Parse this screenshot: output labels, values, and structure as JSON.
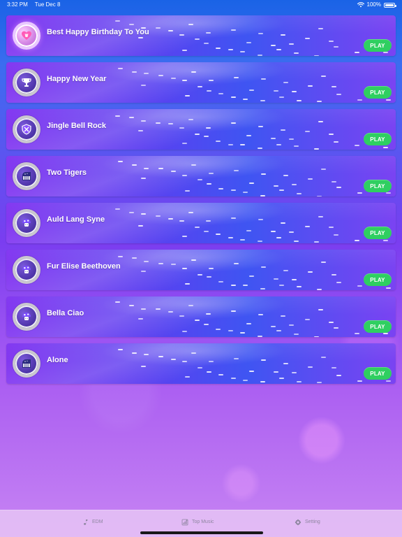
{
  "status_bar": {
    "time": "3:32 PM",
    "date": "Tue Dec 8",
    "battery": "100%",
    "icons": [
      "wifi-icon",
      "battery-icon"
    ]
  },
  "songs": [
    {
      "title": "Best Happy Birthday To You",
      "button": "PLAY",
      "icon": "heart-icon"
    },
    {
      "title": "Happy New Year",
      "button": "PLAY",
      "icon": "trophy-icon"
    },
    {
      "title": "Jingle Bell Rock",
      "button": "PLAY",
      "icon": "shield-icon"
    },
    {
      "title": "Two Tigers",
      "button": "PLAY",
      "icon": "piano-icon"
    },
    {
      "title": "Auld Lang Syne",
      "button": "PLAY",
      "icon": "mushroom-icon"
    },
    {
      "title": "Fur Elise Beethoven",
      "button": "PLAY",
      "icon": "mushroom-icon"
    },
    {
      "title": "Bella Ciao",
      "button": "PLAY",
      "icon": "mushroom-icon"
    },
    {
      "title": "Alone",
      "button": "PLAY",
      "icon": "piano-icon"
    }
  ],
  "tabs": [
    {
      "label": "EDM",
      "icon": "music-note-icon"
    },
    {
      "label": "Top Music",
      "icon": "chart-icon"
    },
    {
      "label": "Setting",
      "icon": "gear-icon"
    }
  ],
  "colors": {
    "play_green": "#2fcf61",
    "tab_text": "#8f86a1",
    "title_white": "#ffffff"
  }
}
